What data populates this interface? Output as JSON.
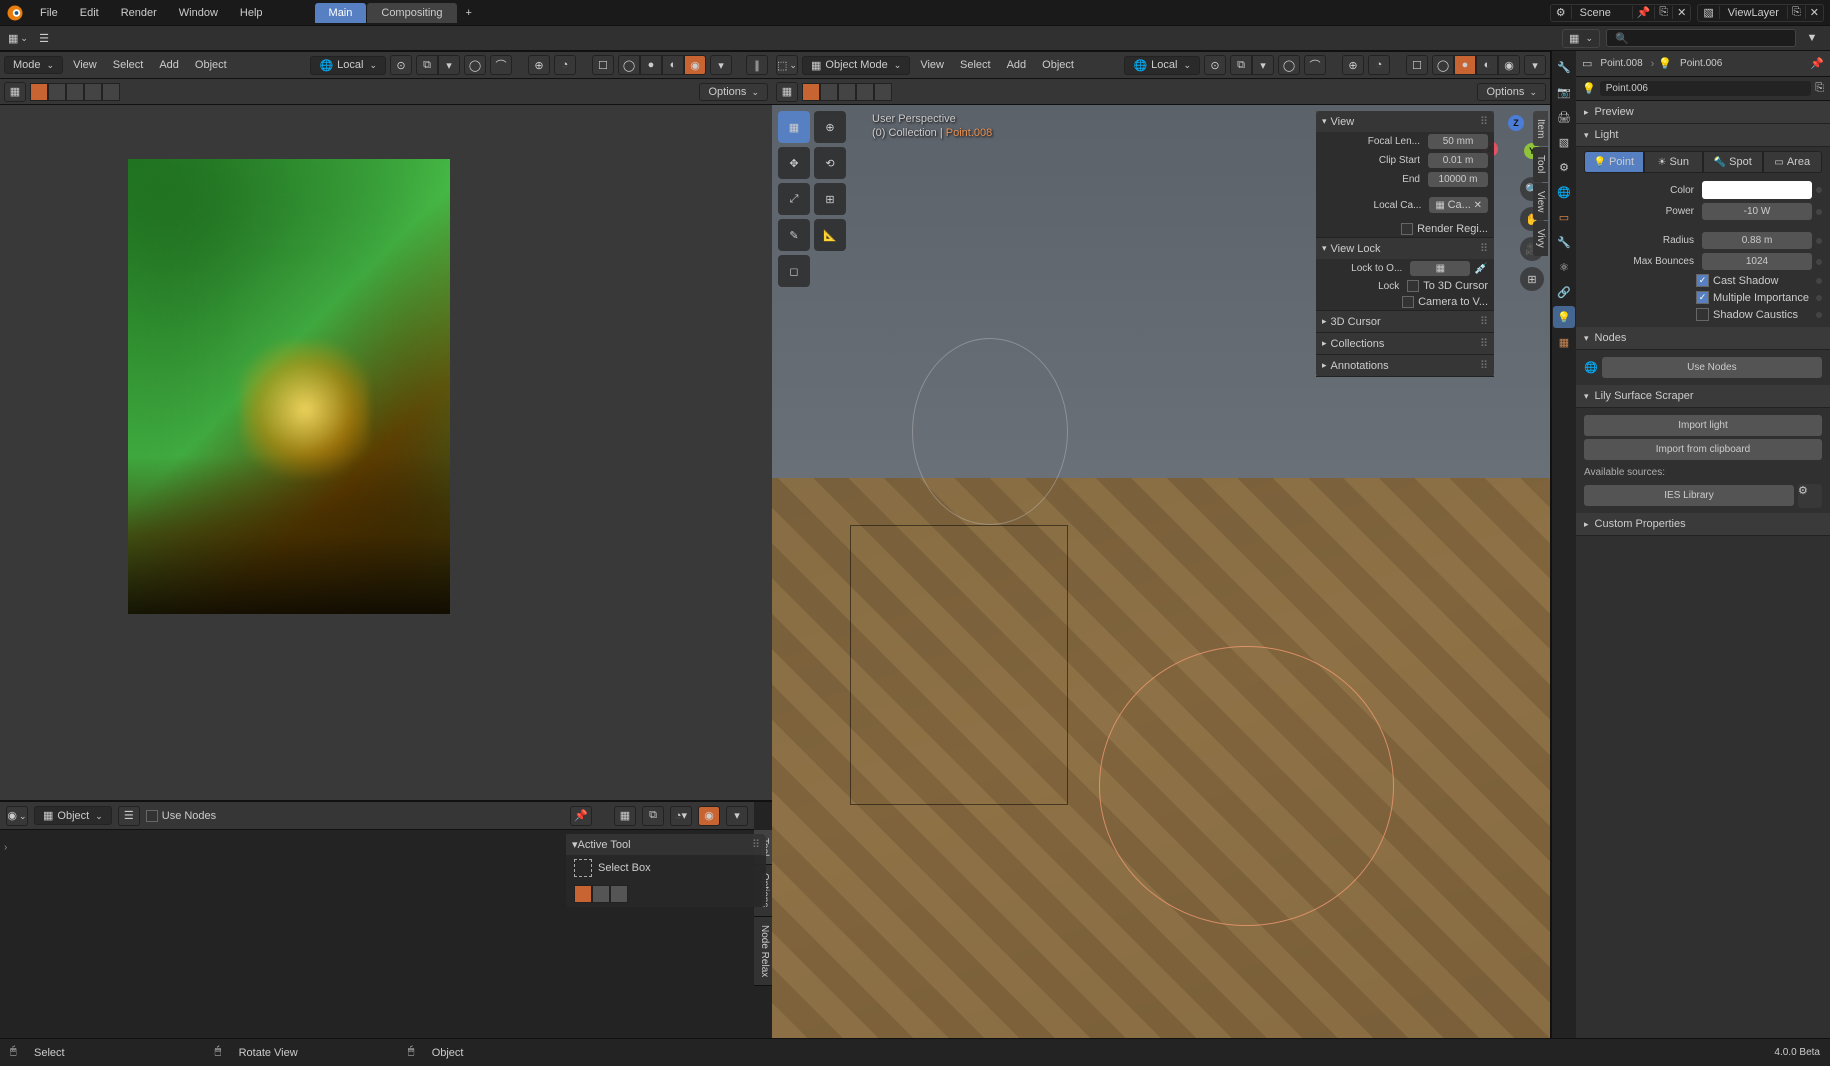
{
  "topbar": {
    "menus": [
      "File",
      "Edit",
      "Render",
      "Window",
      "Help"
    ],
    "tabs": {
      "main": "Main",
      "compositing": "Compositing"
    },
    "scene_label": "Scene",
    "viewlayer_label": "ViewLayer"
  },
  "viewport_header": {
    "mode_label": "Mode",
    "view": "View",
    "select": "Select",
    "add": "Add",
    "object": "Object",
    "orientation": "Local",
    "object_mode": "Object Mode",
    "options": "Options"
  },
  "overlay": {
    "perspective": "User Perspective",
    "collection_line_prefix": "(0) Collection | ",
    "active_object": "Point.008"
  },
  "npanel": {
    "tabs": {
      "item": "Item",
      "tool": "Tool",
      "view": "View",
      "vivy": "Vivy"
    },
    "view": {
      "title": "View",
      "focal_label": "Focal Len...",
      "focal_value": "50 mm",
      "clip_start_label": "Clip Start",
      "clip_start_value": "0.01 m",
      "end_label": "End",
      "end_value": "10000 m",
      "local_cam_label": "Local Ca...",
      "local_cam_value": "Ca...",
      "render_region": "Render Regi..."
    },
    "view_lock": {
      "title": "View Lock",
      "lock_to_label": "Lock to O...",
      "lock_label": "Lock",
      "to_3d_cursor": "To 3D Cursor",
      "camera_to_view": "Camera to V..."
    },
    "cursor_title": "3D Cursor",
    "collections_title": "Collections",
    "annotations_title": "Annotations"
  },
  "bottom_editor": {
    "object_label": "Object",
    "use_nodes": "Use Nodes",
    "active_tool": "Active Tool",
    "select_box": "Select Box",
    "tabs": {
      "tool": "Tool",
      "options": "Options",
      "node_relax": "Node Relax"
    }
  },
  "breadcrumb": {
    "item1": "Point.008",
    "item2": "Point.006"
  },
  "datablock": {
    "name": "Point.006"
  },
  "panels": {
    "preview": "Preview",
    "light": "Light",
    "nodes": "Nodes",
    "use_nodes_btn": "Use Nodes",
    "lily": "Lily Surface Scraper",
    "import_light": "Import light",
    "import_clipboard": "Import from clipboard",
    "available_sources": "Available sources:",
    "ies_library": "IES Library",
    "custom_props": "Custom Properties"
  },
  "light": {
    "types": {
      "point": "Point",
      "sun": "Sun",
      "spot": "Spot",
      "area": "Area"
    },
    "color_label": "Color",
    "color_value": "#FFFFFF",
    "power_label": "Power",
    "power_value": "-10 W",
    "radius_label": "Radius",
    "radius_value": "0.88 m",
    "max_bounces_label": "Max Bounces",
    "max_bounces_value": "1024",
    "cast_shadow": "Cast Shadow",
    "multiple_importance": "Multiple Importance",
    "shadow_caustics": "Shadow Caustics"
  },
  "statusbar": {
    "select": "Select",
    "rotate_view": "Rotate View",
    "object_menu": "Object",
    "version": "4.0.0 Beta"
  }
}
